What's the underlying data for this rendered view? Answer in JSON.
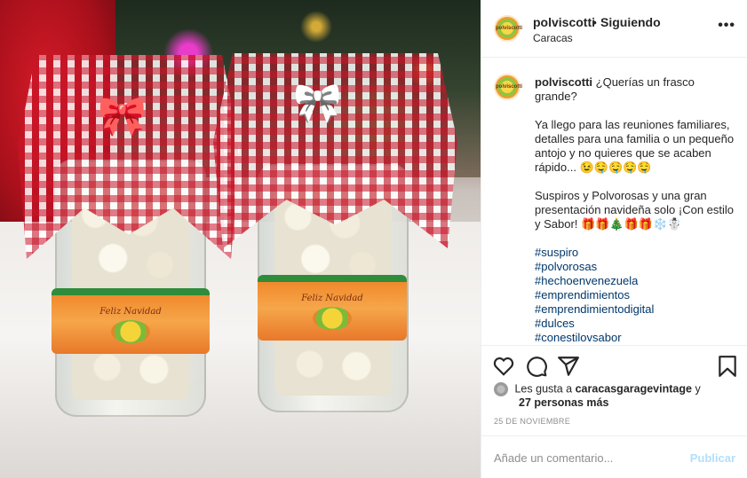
{
  "post": {
    "username": "polviscotti",
    "separator": "•",
    "follow_status": "Siguiendo",
    "location": "Caracas",
    "more_label": "•••",
    "avatar_text": "polviscotti"
  },
  "photo": {
    "label_script": "Feliz Navidad",
    "logo_text": "polviscotti"
  },
  "caption": {
    "username": "polviscotti",
    "intro": "¿Querías un frasco grande?",
    "paragraph1": "Ya llego para las reuniones familiares, detalles para una familia o un pequeño antojo y no quieres que se acaben rápido... 😉🤤🤤🤤🤤",
    "paragraph2": "Suspiros y Polvorosas y una gran presentación navideña solo ¡Con estilo y Sabor! 🎁🎁🎄🎁🎁❄️☃️",
    "hashtags": [
      "#suspiro",
      "#polvorosas",
      "#hechoenvenezuela",
      "#emprendimientos",
      "#emprendimientodigital",
      "#dulces",
      "#conestilovsabor"
    ]
  },
  "actions": {
    "icons": [
      "heart-icon",
      "comment-icon",
      "share-icon",
      "bookmark-icon"
    ]
  },
  "likes": {
    "prefix": "Les gusta a",
    "user": "caracasgaragevintage",
    "connector": "y",
    "others": "27 personas más"
  },
  "date": "25 DE NOVIEMBRE",
  "comment": {
    "placeholder": "Añade un comentario...",
    "publish_label": "Publicar"
  }
}
